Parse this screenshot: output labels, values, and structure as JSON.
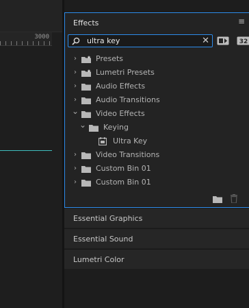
{
  "timeline": {
    "ruler_label": "3000"
  },
  "effects_panel": {
    "title": "Effects",
    "menu_icon": "hamburger-icon",
    "search": {
      "value": "ultra key",
      "placeholder": ""
    },
    "toolbar_icons": [
      "accelerated-effects-icon",
      "32-bit-color-icon"
    ],
    "tree": [
      {
        "label": "Presets",
        "indent": 0,
        "expanded": false,
        "icon": "star-folder-icon"
      },
      {
        "label": "Lumetri Presets",
        "indent": 0,
        "expanded": false,
        "icon": "star-folder-icon"
      },
      {
        "label": "Audio Effects",
        "indent": 0,
        "expanded": false,
        "icon": "folder-icon"
      },
      {
        "label": "Audio Transitions",
        "indent": 0,
        "expanded": false,
        "icon": "folder-icon"
      },
      {
        "label": "Video Effects",
        "indent": 0,
        "expanded": true,
        "icon": "folder-icon"
      },
      {
        "label": "Keying",
        "indent": 1,
        "expanded": true,
        "icon": "folder-icon"
      },
      {
        "label": "Ultra Key",
        "indent": 2,
        "expanded": null,
        "icon": "effect-icon"
      },
      {
        "label": "Video Transitions",
        "indent": 0,
        "expanded": false,
        "icon": "folder-icon"
      },
      {
        "label": "Custom Bin 01",
        "indent": 0,
        "expanded": false,
        "icon": "folder-icon"
      },
      {
        "label": "Custom Bin 01",
        "indent": 0,
        "expanded": false,
        "icon": "folder-icon"
      }
    ],
    "footer_icons": [
      "new-bin-icon",
      "delete-icon"
    ]
  },
  "collapsed_panels": [
    "Essential Graphics",
    "Essential Sound",
    "Lumetri Color"
  ],
  "colors": {
    "accent": "#2d8ceb",
    "playhead_line": "#3fbfbf",
    "panel_bg": "#232323"
  }
}
